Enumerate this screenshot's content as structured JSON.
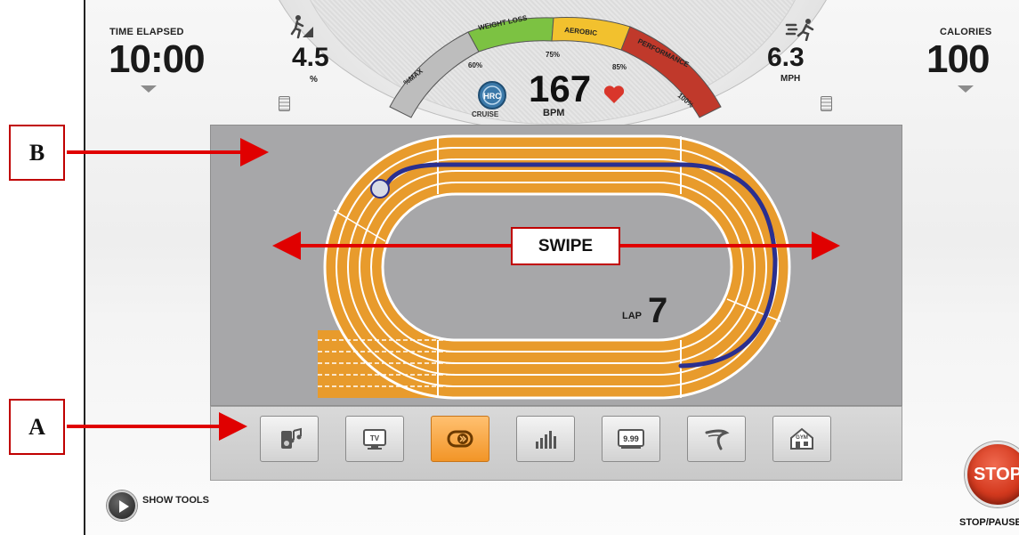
{
  "top_stats": {
    "time_elapsed": {
      "label": "TIME ELAPSED",
      "value": "10:00"
    },
    "incline": {
      "value": "4.5",
      "unit": "%"
    },
    "speed": {
      "value": "6.3",
      "unit": "MPH"
    },
    "calories": {
      "label": "CALORIES",
      "value": "100"
    }
  },
  "heart_rate": {
    "value": "167",
    "unit": "BPM",
    "mode_label": "CRUISE",
    "mode_badge": "HRC",
    "zones": [
      {
        "label": "%MAX",
        "color": "#bdbdbd"
      },
      {
        "label": "WEIGHT LOSS",
        "color": "#7cc242"
      },
      {
        "label": "AEROBIC",
        "color": "#f2c12e"
      },
      {
        "label": "PERFORMANCE",
        "color": "#c0392b"
      }
    ],
    "percent_ticks": [
      "60%",
      "75%",
      "85%",
      "100%"
    ]
  },
  "track": {
    "lap_label": "LAP",
    "lap_value": "7",
    "track_color": "#e89b2c",
    "path_color": "#2a2f8f"
  },
  "tool_tray": {
    "buttons": [
      {
        "icon": "music-icon"
      },
      {
        "icon": "tv-icon",
        "text": "TV"
      },
      {
        "icon": "track-loop-icon",
        "active": true
      },
      {
        "icon": "bar-chart-icon"
      },
      {
        "icon": "price-tag-icon",
        "text": "9.99"
      },
      {
        "icon": "road-icon"
      },
      {
        "icon": "gym-icon",
        "text": "GYM"
      }
    ]
  },
  "controls": {
    "show_tools_label": "SHOW TOOLS",
    "stop_label": "STOP",
    "stop_caption": "STOP/PAUSE"
  },
  "annotations": {
    "callout_b": "B",
    "callout_a": "A",
    "swipe_label": "SWIPE",
    "arrow_color": "#e00000"
  }
}
